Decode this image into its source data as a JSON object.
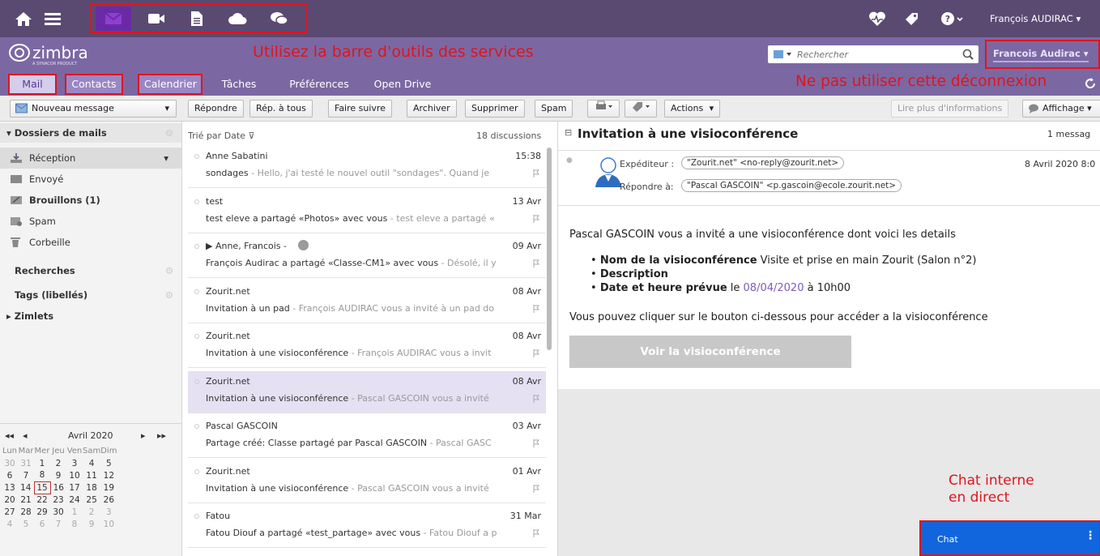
{
  "topbar": {
    "user": "François AUDIRAC",
    "icons": [
      "home-icon",
      "menu-icon",
      "mail-icon",
      "video-icon",
      "document-icon",
      "cloud-icon",
      "chat-icon",
      "heartbeat-icon",
      "tag-icon",
      "help-icon"
    ]
  },
  "header": {
    "logo_text": "zimbra",
    "logo_sub": "A SYNACOR PRODUCT",
    "annotation": "Utilisez la barre d'outils des services",
    "search_placeholder": "Rechercher",
    "user_button": "Francois Audirac"
  },
  "apptabs": {
    "mail": "Mail",
    "contacts": "Contacts",
    "calendar": "Calendrier",
    "tasks": "Tâches",
    "prefs": "Préférences",
    "drive": "Open Drive",
    "annotation": "Ne pas utiliser cette déconnexion"
  },
  "toolbar": {
    "new_message": "Nouveau message",
    "reply": "Répondre",
    "reply_all": "Rép. à tous",
    "forward": "Faire suivre",
    "archive": "Archiver",
    "delete": "Supprimer",
    "spam": "Spam",
    "actions": "Actions",
    "read_more": "Lire plus d'informations",
    "view": "Affichage"
  },
  "sidebar": {
    "mail_folders": "Dossiers de mails",
    "folders": [
      {
        "label": "Réception",
        "bold": false
      },
      {
        "label": "Envoyé",
        "bold": false
      },
      {
        "label": "Brouillons (1)",
        "bold": true
      },
      {
        "label": "Spam",
        "bold": false
      },
      {
        "label": "Corbeille",
        "bold": false
      }
    ],
    "searches": "Recherches",
    "tags": "Tags (libellés)",
    "zimlets": "Zimlets"
  },
  "calendar": {
    "title": "Avril 2020",
    "days": [
      "Lun",
      "Mar",
      "Mer",
      "Jeu",
      "Ven",
      "Sam",
      "Dim"
    ],
    "weeks": [
      [
        "30",
        "31",
        "1",
        "2",
        "3",
        "4",
        "5"
      ],
      [
        "6",
        "7",
        "8",
        "9",
        "10",
        "11",
        "12"
      ],
      [
        "13",
        "14",
        "15",
        "16",
        "17",
        "18",
        "19"
      ],
      [
        "20",
        "21",
        "22",
        "23",
        "24",
        "25",
        "26"
      ],
      [
        "27",
        "28",
        "29",
        "30",
        "1",
        "2",
        "3"
      ],
      [
        "4",
        "5",
        "6",
        "7",
        "8",
        "9",
        "10"
      ]
    ]
  },
  "list": {
    "sort_label": "Trié par Date",
    "count": "18 discussions",
    "rows": [
      {
        "from": "Anne Sabatini",
        "date": "15:38",
        "subject": "sondages",
        "fragment": " - Hello, j'ai testé le nouvel outil \"sondages\". Quand je"
      },
      {
        "from": "test",
        "date": "13 Avr",
        "subject": "test eleve a partagé «Photos» avec vous",
        "fragment": " - test eleve a partagé «"
      },
      {
        "from": "▶ Anne, Francois -",
        "date": "09 Avr",
        "subject": "François Audirac a partagé «Classe-CM1» avec vous",
        "fragment": " - Désolé, il y"
      },
      {
        "from": "Zourit.net",
        "date": "08 Avr",
        "subject": "Invitation à un pad",
        "fragment": " - François AUDIRAC vous a invité à un pad do"
      },
      {
        "from": "Zourit.net",
        "date": "08 Avr",
        "subject": "Invitation à une visioconférence",
        "fragment": " - François AUDIRAC vous a invit"
      },
      {
        "from": "Zourit.net",
        "date": "08 Avr",
        "subject": "Invitation à une visioconférence",
        "fragment": " - Pascal GASCOIN vous a invité"
      },
      {
        "from": "Pascal GASCOIN",
        "date": "03 Avr",
        "subject": "Partage créé: Classe partagé par Pascal GASCOIN",
        "fragment": " - Pascal GASC"
      },
      {
        "from": "Zourit.net",
        "date": "01 Avr",
        "subject": "Invitation à une visioconférence",
        "fragment": " - Pascal GASCOIN vous a invité"
      },
      {
        "from": "Fatou",
        "date": "31 Mar",
        "subject": "Fatou Diouf a partagé «test_partage» avec vous",
        "fragment": " - Fatou Diouf a p"
      }
    ]
  },
  "reading": {
    "title": "Invitation à une visioconférence",
    "count": "1 messag",
    "sender_label": "Expéditeur :",
    "sender": "\"Zourit.net\" <no-reply@zourit.net>",
    "date": "8 Avril 2020 8:0",
    "reply_label": "Répondre à:",
    "reply_to": "\"Pascal GASCOIN\" <p.gascoin@ecole.zourit.net>",
    "intro": "Pascal GASCOIN vous a invité a une visioconférence dont voici les details",
    "b1_bold": "Nom de la visioconférence",
    "b1_text": " Visite et prise en main Zourit (Salon n°2)",
    "b2_bold": "Description",
    "b3_bold": "Date et heure prévue",
    "b3_mid": " le ",
    "b3_link": "08/04/2020",
    "b3_end": " à 10h00",
    "cta_text": "Vous pouvez cliquer sur le bouton ci-dessous pour accéder a la visioconférence",
    "button": "Voir la visioconférence"
  },
  "chat": {
    "annotation_line1": "Chat interne",
    "annotation_line2": "en direct",
    "label": "Chat"
  },
  "colors": {
    "topbar": "#5a4a72",
    "header": "#7b68a3",
    "annotation_red": "#e0141e",
    "chat_blue": "#1166dd"
  }
}
